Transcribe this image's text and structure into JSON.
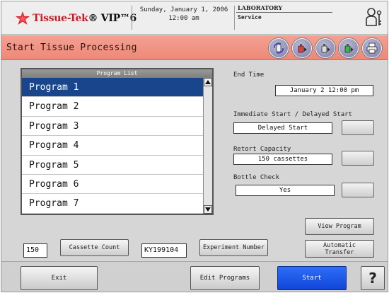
{
  "header": {
    "logo_brand": "Tissue-Tek",
    "logo_rest": "® VIP™6",
    "date": "Sunday, January 1, 2006",
    "time": "12:00 am",
    "role_title": "LABORATORY",
    "role_sub": "Service",
    "icons": [
      "star-logo-icon",
      "user-key-icon"
    ]
  },
  "titlebar": {
    "title": "Start Tissue Processing",
    "action_icons": [
      "reagent-rotate-icon",
      "bottle-red-icon",
      "bottle-gray-icon",
      "bottle-green-icon",
      "printer-icon"
    ]
  },
  "program_list": {
    "header": "Program List",
    "items": [
      "Program 1",
      "Program 2",
      "Program 3",
      "Program 4",
      "Program 5",
      "Program 6",
      "Program 7"
    ],
    "selected_index": 0
  },
  "end_time": {
    "label": "End Time",
    "value": "January 2  12:00 pm"
  },
  "start_mode": {
    "label": "Immediate Start / Delayed Start",
    "value": "Delayed Start"
  },
  "retort_capacity": {
    "label": "Retort Capacity",
    "value": "150 cassettes"
  },
  "bottle_check": {
    "label": "Bottle Check",
    "value": "Yes"
  },
  "buttons": {
    "view_program": "View Program",
    "automatic_transfer_line1": "Automatic",
    "automatic_transfer_line2": "Transfer",
    "cassette_count": "Cassette Count",
    "experiment_number": "Experiment Number",
    "exit": "Exit",
    "edit_programs": "Edit Programs",
    "start": "Start",
    "help": "?"
  },
  "inputs": {
    "cassette_count_value": "150",
    "experiment_number_value": "KY199104"
  },
  "colors": {
    "titlebar": "#ee8878",
    "selected_row": "#18458c",
    "start_button": "#1f5ae8",
    "brand_red": "#c0202a"
  }
}
